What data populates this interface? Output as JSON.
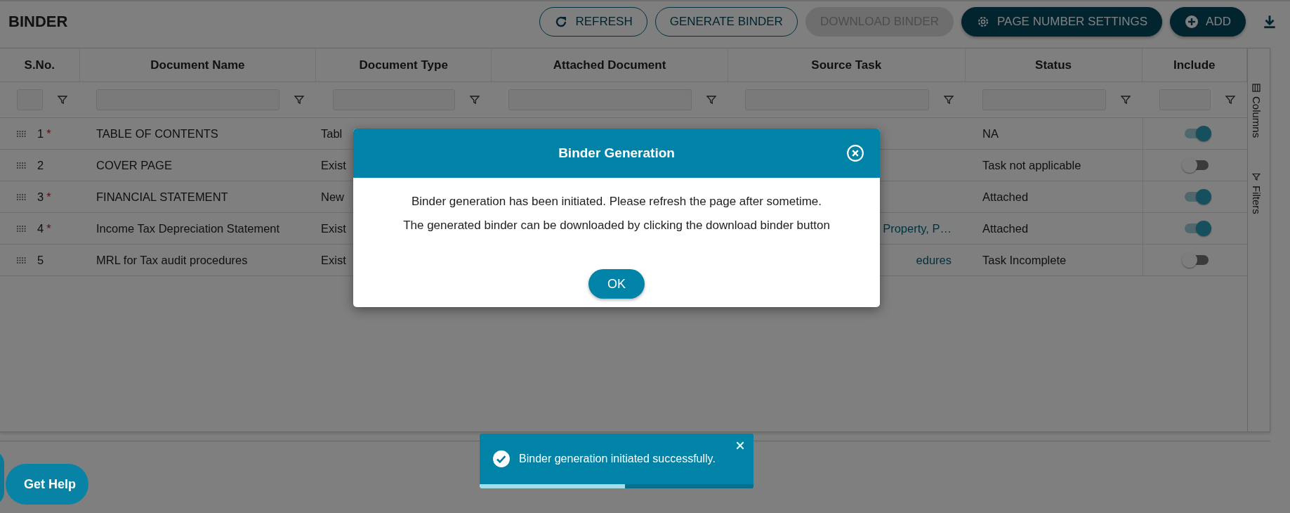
{
  "header": {
    "title": "BINDER",
    "buttons": [
      {
        "label": "REFRESH",
        "kind": "outline"
      },
      {
        "label": "GENERATE BINDER",
        "kind": "outline"
      },
      {
        "label": "DOWNLOAD BINDER",
        "kind": "disabled"
      },
      {
        "label": "PAGE NUMBER SETTINGS",
        "kind": "filled"
      },
      {
        "label": "ADD",
        "kind": "filled"
      }
    ]
  },
  "table": {
    "columns": [
      "S.No.",
      "Document Name",
      "Document Type",
      "Attached Document",
      "Source Task",
      "Status",
      "Include"
    ],
    "rows": [
      {
        "sno": "1",
        "asterisk": "*",
        "name": "TABLE OF CONTENTS",
        "type": "Tabl",
        "source": "",
        "status": "NA",
        "include": true
      },
      {
        "sno": "2",
        "name": "COVER PAGE",
        "type": "Exist",
        "source": "",
        "status": "Task not applicable",
        "include": false
      },
      {
        "sno": "3",
        "asterisk": "*",
        "name": "FINANCIAL STATEMENT",
        "type": "New",
        "source": "",
        "status": "Attached",
        "include": true
      },
      {
        "sno": "4",
        "asterisk": "*",
        "name": "Income Tax Depreciation Statement",
        "type": "Exist",
        "source": "Property, P…",
        "status": "Attached",
        "include": true
      },
      {
        "sno": "5",
        "name": "MRL for Tax audit procedures",
        "type": "Exist",
        "source": "edures",
        "status": "Task Incomplete",
        "include": false
      }
    ],
    "side_panel": [
      "Columns",
      "Filters"
    ]
  },
  "modal": {
    "title": "Binder Generation",
    "lines": [
      "Binder generation has been initiated. Please refresh the page after sometime.",
      "The generated binder can be downloaded by clicking the download binder button"
    ],
    "button": "OK"
  },
  "toast": {
    "message": "Binder generation initiated successfully.",
    "level": 0.53
  },
  "help": {
    "label": "Get Help"
  }
}
